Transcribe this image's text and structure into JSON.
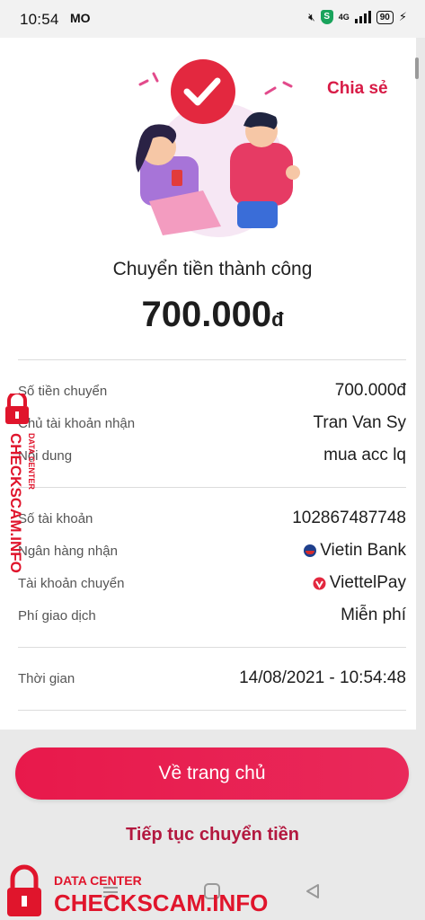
{
  "status_bar": {
    "time": "10:54",
    "extra": "MO",
    "network": "4G",
    "battery": "90",
    "shield": "S"
  },
  "header": {
    "share_label": "Chia sẻ"
  },
  "result": {
    "title": "Chuyển tiền thành công",
    "amount": "700.000",
    "currency": "đ"
  },
  "details_group1": [
    {
      "label": "Số tiền chuyển",
      "value": "700.000đ"
    },
    {
      "label": "Chủ tài khoản nhận",
      "value": "Tran Van Sy"
    },
    {
      "label": "Nội dung",
      "value": "mua acc lq"
    }
  ],
  "details_group2": [
    {
      "label": "Số tài khoản",
      "value": "102867487748"
    },
    {
      "label": "Ngân hàng nhận",
      "value": "Vietin Bank",
      "icon": "vietinbank-logo-icon"
    },
    {
      "label": "Tài khoản chuyển",
      "value": "ViettelPay",
      "icon": "viettelpay-logo-icon"
    },
    {
      "label": "Phí giao dịch",
      "value": "Miễn phí"
    }
  ],
  "details_group3": [
    {
      "label": "Thời gian",
      "value": "14/08/2021 - 10:54:48"
    }
  ],
  "actions": {
    "home_label": "Về trang chủ",
    "continue_label": "Tiếp tục chuyển tiền"
  },
  "watermark": {
    "line1": "DATA CENTER",
    "line2": "CHECKSCAM.INFO"
  },
  "colors": {
    "accent": "#e8194b",
    "share": "#d81b46",
    "continue": "#b3183f",
    "watermark": "#e0152c"
  }
}
